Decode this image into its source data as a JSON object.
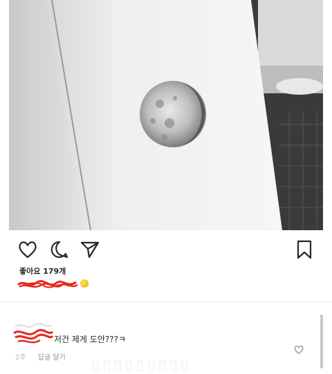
{
  "post": {
    "image_icon": "photo-moon-drawing",
    "likes_text": "좋아요 179개",
    "caption_emoji_icon": "yellow-moon-emoji"
  },
  "actions": {
    "like_icon": "heart-outline-icon",
    "comment_icon": "comment-bubble-icon",
    "share_icon": "paper-plane-icon",
    "save_icon": "bookmark-icon"
  },
  "comment": {
    "text": "저건 제게 도안???ㅋ",
    "time": "2주",
    "reply_label": "답글 달기",
    "like_icon": "heart-outline-icon"
  },
  "colors": {
    "redaction": "#e8261e",
    "text": "#262626",
    "muted": "#8e8e8e"
  }
}
